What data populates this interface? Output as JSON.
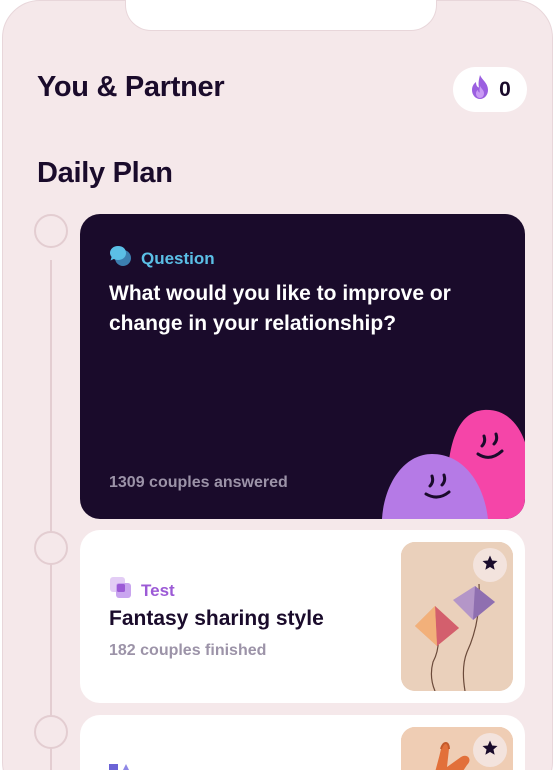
{
  "header": {
    "title": "You & Partner",
    "streak_icon": "flame-icon",
    "streak_count": "0"
  },
  "section": {
    "title": "Daily Plan"
  },
  "question_card": {
    "icon": "speech-bubble-icon",
    "label": "Question",
    "text": "What would you like to improve or change in your relationship?",
    "footer": "1309 couples answered"
  },
  "test_card": {
    "icon": "test-squares-icon",
    "label": "Test",
    "title": "Fantasy sharing style",
    "subtitle": "182 couples finished",
    "thumbnail": "kites-image",
    "badge_icon": "star-icon"
  },
  "third_card": {
    "icon": "shapes-icon",
    "thumbnail": "hand-image",
    "badge_icon": "star-icon"
  },
  "colors": {
    "background": "#f5e8ea",
    "dark_card": "#1a0b2b",
    "question_accent": "#5bbfe6",
    "test_accent": "#9c5ad6",
    "muted_text": "#9c93a8",
    "blob_purple": "#b57ae6",
    "blob_pink": "#f545a8"
  }
}
